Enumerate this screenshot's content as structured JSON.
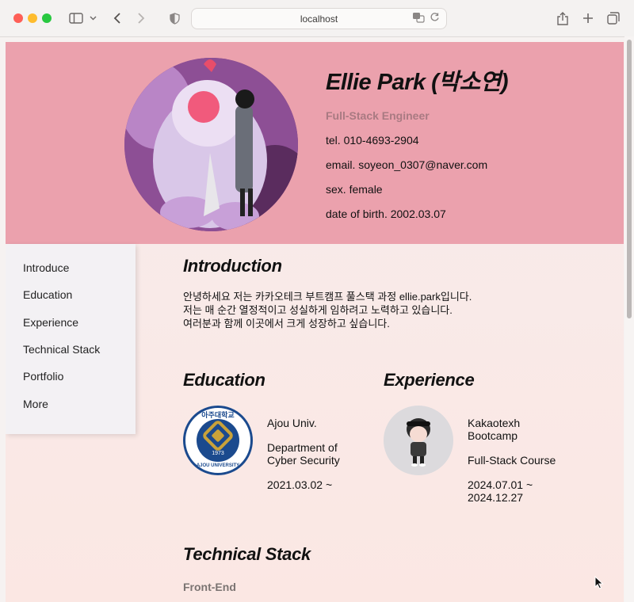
{
  "browser": {
    "url": "localhost"
  },
  "profile": {
    "name": "Ellie Park (박소연)",
    "role": "Full-Stack Engineer",
    "tel": "tel. 010-4693-2904",
    "email": "email. soyeon_0307@naver.com",
    "sex": "sex. female",
    "birth": "date of birth. 2002.03.07"
  },
  "nav": {
    "items": [
      "Introduce",
      "Education",
      "Experience",
      "Technical Stack",
      "Portfolio",
      "More"
    ]
  },
  "introduction": {
    "title": "Introduction",
    "lines": [
      "안녕하세요 저는 카카오테크 부트캠프 풀스택 과정 ellie.park입니다.",
      "저는 매 순간 열정적이고 성실하게 임하려고 노력하고 있습니다.",
      "여러분과 함께 이곳에서 크게 성장하고 싶습니다."
    ]
  },
  "education": {
    "title": "Education",
    "logo_top": "아주대학교",
    "logo_year": "1973",
    "logo_ring": "AJOU UNIVERSITY",
    "school": "Ajou Univ.",
    "dept_line1": "Department of",
    "dept_line2": "Cyber Security",
    "date": "2021.03.02 ~"
  },
  "experience": {
    "title": "Experience",
    "org_line1": "Kakaotexh",
    "org_line2": "Bootcamp",
    "course": "Full-Stack Course",
    "date_line1": "2024.07.01 ~",
    "date_line2": "2024.12.27"
  },
  "tech": {
    "title": "Technical Stack",
    "sub": "Front-End"
  },
  "colors": {
    "hero": "#eba1ad",
    "role": "#a97a82",
    "logo_blue": "#1b4a8e"
  }
}
